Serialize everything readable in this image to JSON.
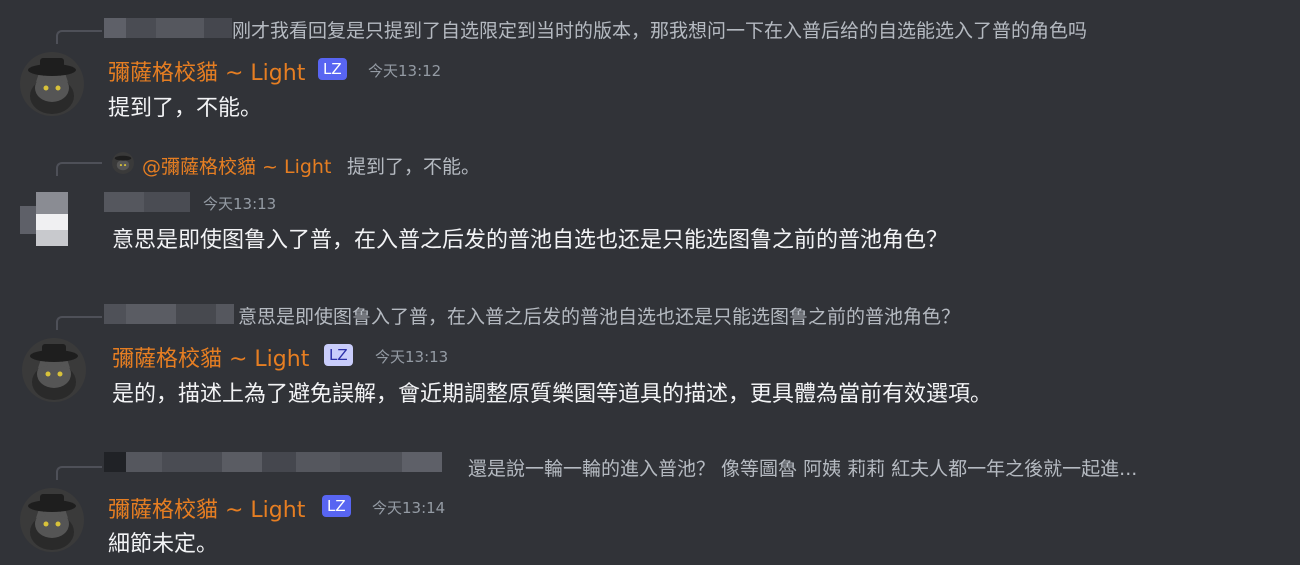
{
  "messages": [
    {
      "reply_text": "刚才我看回复是只提到了自选限定到当时的版本，那我想问一下在入普后给的自选能选入了普的角色吗",
      "author": "彌薩格校貓 ~ Light",
      "badge": "LZ",
      "timestamp": "今天13:12",
      "content": "提到了，不能。"
    },
    {
      "reply_author": "@彌薩格校貓 ~ Light",
      "reply_text": "提到了，不能。",
      "timestamp": "今天13:13",
      "content": "意思是即使图鲁入了普，在入普之后发的普池自选也还是只能选图鲁之前的普池角色？"
    },
    {
      "reply_text": "意思是即使图鲁入了普，在入普之后发的普池自选也还是只能选图鲁之前的普池角色？",
      "author": "彌薩格校貓 ~ Light",
      "badge": "LZ",
      "timestamp": "今天13:13",
      "content": "是的，描述上為了避免誤解，會近期調整原質樂園等道具的描述，更具體為當前有效選項。"
    },
    {
      "reply_text": "還是說一輪一輪的進入普池？ 像等圖魯 阿姨 莉莉 紅夫人都一年之後就一起進...",
      "author": "彌薩格校貓 ~ Light",
      "badge": "LZ",
      "timestamp": "今天13:14",
      "content": "細節未定。"
    }
  ],
  "colors": {
    "background": "#313338",
    "author_name": "#e67e22",
    "timestamp": "#949ba4",
    "message_text": "#f2f3f5",
    "reply_text": "#b5bac1",
    "badge": "#5865f2"
  },
  "icons": {
    "avatar": "cat-with-hat-avatar",
    "blurred_avatar": "blurred-avatar"
  }
}
